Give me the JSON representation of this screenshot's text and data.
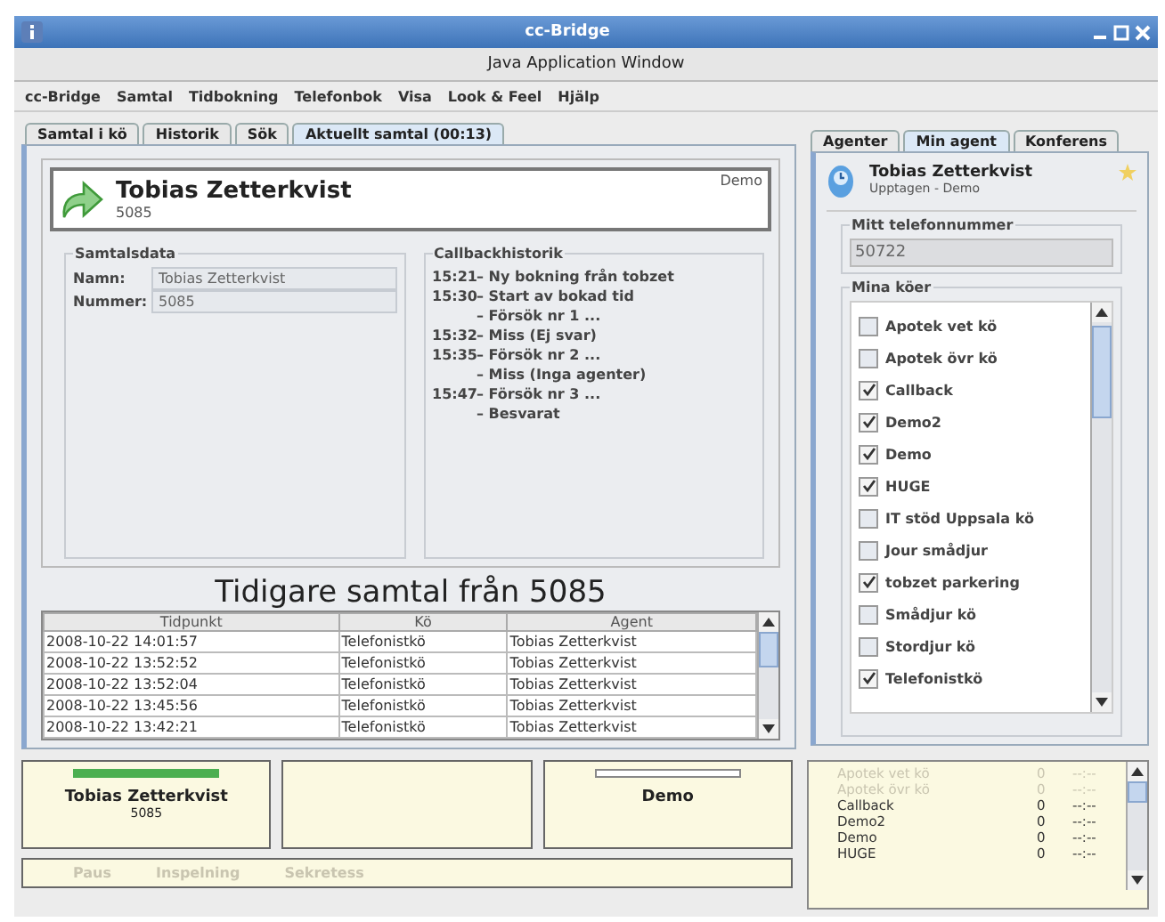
{
  "window": {
    "title": "cc-Bridge",
    "subtitle": "Java Application Window"
  },
  "menu": [
    "cc-Bridge",
    "Samtal",
    "Tidbokning",
    "Telefonbok",
    "Visa",
    "Look & Feel",
    "Hjälp"
  ],
  "left_tabs": [
    {
      "label": "Samtal i kö",
      "selected": false
    },
    {
      "label": "Historik",
      "selected": false
    },
    {
      "label": "Sök",
      "selected": false
    },
    {
      "label": "Aktuellt samtal (00:13)",
      "selected": true
    }
  ],
  "call": {
    "name": "Tobias Zetterkvist",
    "number": "5085",
    "queue": "Demo"
  },
  "call_data": {
    "title": "Samtalsdata",
    "fields": [
      {
        "label": "Namn:",
        "value": "Tobias Zetterkvist"
      },
      {
        "label": "Nummer:",
        "value": "5085"
      }
    ]
  },
  "callback_history": {
    "title": "Callbackhistorik",
    "entries": [
      {
        "time": "15:21",
        "text": "– Ny bokning från tobzet"
      },
      {
        "time": "15:30",
        "text": "– Start av bokad tid"
      },
      {
        "text": "– Försök nr 1 ..."
      },
      {
        "time": "15:32",
        "text": "– Miss (Ej svar)"
      },
      {
        "time": "15:35",
        "text": "– Försök nr 2 ..."
      },
      {
        "text": "– Miss (Inga agenter)"
      },
      {
        "time": "15:47",
        "text": "– Försök nr 3 ..."
      },
      {
        "text": "– Besvarat"
      }
    ]
  },
  "history": {
    "heading": "Tidigare samtal från 5085",
    "columns": [
      "Tidpunkt",
      "Kö",
      "Agent"
    ],
    "rows": [
      [
        "2008-10-22 14:01:57",
        "Telefonistkö",
        "Tobias Zetterkvist"
      ],
      [
        "2008-10-22 13:52:52",
        "Telefonistkö",
        "Tobias Zetterkvist"
      ],
      [
        "2008-10-22 13:52:04",
        "Telefonistkö",
        "Tobias Zetterkvist"
      ],
      [
        "2008-10-22 13:45:56",
        "Telefonistkö",
        "Tobias Zetterkvist"
      ],
      [
        "2008-10-22 13:42:21",
        "Telefonistkö",
        "Tobias Zetterkvist"
      ]
    ]
  },
  "right_tabs": [
    {
      "label": "Agenter",
      "selected": false
    },
    {
      "label": "Min agent",
      "selected": true
    },
    {
      "label": "Konferens",
      "selected": false
    }
  ],
  "agent": {
    "name": "Tobias Zetterkvist",
    "status": "Upptagen - Demo",
    "phone_label": "Mitt telefonnummer",
    "phone": "50722",
    "queues_label": "Mina köer"
  },
  "queues": [
    {
      "label": "Apotek vet kö",
      "checked": false
    },
    {
      "label": "Apotek övr kö",
      "checked": false
    },
    {
      "label": "Callback",
      "checked": true
    },
    {
      "label": "Demo2",
      "checked": true
    },
    {
      "label": "Demo",
      "checked": true
    },
    {
      "label": "HUGE",
      "checked": true
    },
    {
      "label": "IT stöd Uppsala kö",
      "checked": false
    },
    {
      "label": "Jour smådjur",
      "checked": false
    },
    {
      "label": "tobzet parkering",
      "checked": true
    },
    {
      "label": "Smådjur kö",
      "checked": false
    },
    {
      "label": "Stordjur kö",
      "checked": false
    },
    {
      "label": "Telefonistkö",
      "checked": true
    }
  ],
  "lines": [
    {
      "name": "Tobias Zetterkvist",
      "number": "5085",
      "active": true,
      "has_bar": true
    },
    {
      "has_bar": false
    },
    {
      "name": "Demo",
      "active": false,
      "has_bar": true
    }
  ],
  "controls": [
    {
      "label": "Paus",
      "disabled": true
    },
    {
      "label": "Inspelning",
      "disabled": true
    },
    {
      "label": "Sekretess",
      "disabled": true
    }
  ],
  "queue_status": [
    {
      "name": "Apotek vet kö",
      "count": "0",
      "time": "--:--",
      "disabled": true
    },
    {
      "name": "Apotek övr kö",
      "count": "0",
      "time": "--:--",
      "disabled": true
    },
    {
      "name": "Callback",
      "count": "0",
      "time": "--:--",
      "disabled": false
    },
    {
      "name": "Demo2",
      "count": "0",
      "time": "--:--",
      "disabled": false
    },
    {
      "name": "Demo",
      "count": "0",
      "time": "--:--",
      "disabled": false
    },
    {
      "name": "HUGE",
      "count": "0",
      "time": "--:--",
      "disabled": false
    }
  ]
}
